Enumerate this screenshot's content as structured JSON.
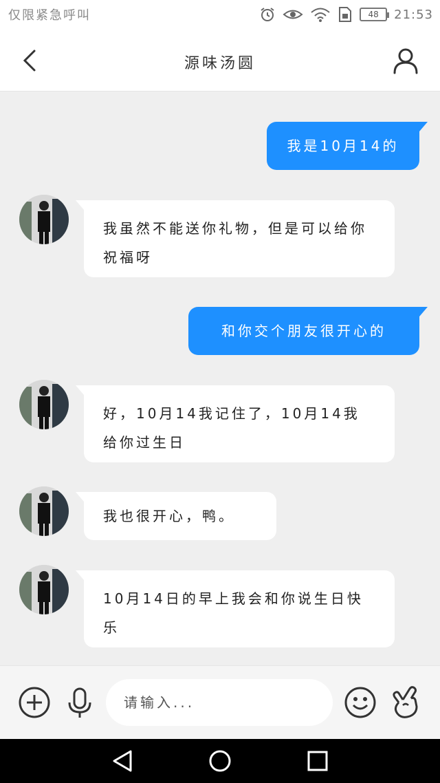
{
  "status_bar": {
    "carrier_text": "仅限紧急呼叫",
    "battery": "48",
    "time": "21:53"
  },
  "header": {
    "title": "源味汤圆"
  },
  "messages": [
    {
      "side": "out",
      "text": "我是10月14的"
    },
    {
      "side": "in",
      "text": "我虽然不能送你礼物，但是可以给你祝福呀"
    },
    {
      "side": "out",
      "text": "和你交个朋友很开心的"
    },
    {
      "side": "in",
      "text": "好，10月14我记住了，10月14我给你过生日"
    },
    {
      "side": "in",
      "text": "我也很开心，鸭。"
    },
    {
      "side": "in",
      "text": "10月14日的早上我会和你说生日快乐"
    }
  ],
  "input": {
    "placeholder": "请输入..."
  },
  "icons": {
    "back": "chevron-left-icon",
    "profile": "user-icon",
    "add": "plus-circle-icon",
    "voice": "microphone-icon",
    "emoji": "smiley-icon",
    "gesture": "finger-heart-icon",
    "alarm": "alarm-clock-icon",
    "eye": "eye-icon",
    "wifi": "wifi-icon",
    "sim": "sim-card-icon",
    "nav_back": "triangle-back-icon",
    "nav_home": "circle-home-icon",
    "nav_recent": "square-recent-icon"
  },
  "colors": {
    "outgoing_bubble": "#1e90ff",
    "incoming_bubble": "#ffffff",
    "chat_background": "#efefef"
  }
}
